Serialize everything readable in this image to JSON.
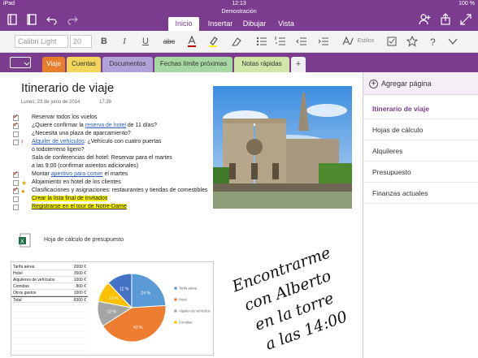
{
  "status_bar": {
    "carrier": "iPad",
    "time": "12:13",
    "battery": "100 %"
  },
  "document_title": "Demostración",
  "ribbon_tabs": [
    "Inicio",
    "Insertar",
    "Dibujar",
    "Vista"
  ],
  "ribbon": {
    "font_name": "Calibri Light",
    "font_size": "20",
    "styles_label": "Estilos"
  },
  "sections": [
    {
      "label": "Viaje",
      "color": "#e87d2b"
    },
    {
      "label": "Cuentas",
      "color": "#f2d65b"
    },
    {
      "label": "Documentos",
      "color": "#b0a1d8"
    },
    {
      "label": "Fechas límite próximas",
      "color": "#a8d8a1"
    },
    {
      "label": "Notas rápidas",
      "color": "#cfe6a7"
    }
  ],
  "pages_panel": {
    "add_label": "Agregar página",
    "pages": [
      "Itinerario de viaje",
      "Hojas de cálculo",
      "Alquileres",
      "Presupuesto",
      "Finanzas actuales"
    ]
  },
  "note": {
    "title": "Itinerario de viaje",
    "date": "Lunes, 23 de junio de 2014",
    "time": "17:36",
    "todos": [
      {
        "text": "Reservar todos los vuelos"
      },
      {
        "pre": "¿Quiere confirmar la ",
        "link": "reserva de hotel",
        "post": " de 11 días?"
      },
      {
        "text": "¿Necesita una plaza de aparcamiento?"
      },
      {
        "link": "Alquiler de vehículos",
        "post": ": ¿Vehículo con cuatro puertas"
      },
      {
        "text": "o todoterreno ligero?"
      },
      {
        "text": "Sala de conferencias del hotel: Reservar para el martes"
      },
      {
        "text": "a las 9:00 (confirmar asientos adicionales)"
      },
      {
        "pre": "Montar ",
        "link": "aperitivo para comer",
        "post": " el martes"
      },
      {
        "text": "Alojamiento en hotel de los clientes"
      },
      {
        "text": "Clasificaciones y asignaciones: restaurantes y tiendas de comestibles"
      },
      {
        "text": "Crear la lista final de invitados"
      },
      {
        "text": "Registrarse en el tour de Notre-Dame"
      }
    ],
    "attachment_label": "Hoja de cálculo de presupuesto",
    "handwriting": [
      "Encontrarme",
      "con Alberto",
      "en la torre",
      "a las 14:00"
    ]
  },
  "spreadsheet": {
    "rows": [
      {
        "label": "Tarifa aérea",
        "value": "2000 €"
      },
      {
        "label": "Hotel",
        "value": "3500 €"
      },
      {
        "label": "Alquileres de vehículos",
        "value": "1000 €"
      },
      {
        "label": "Comidas",
        "value": "800 €"
      },
      {
        "label": "Otros gastos",
        "value": "1000 €"
      },
      {
        "label": "Total",
        "value": "8300 €"
      }
    ]
  },
  "chart_data": {
    "type": "pie",
    "labels": [
      "Tarifa aérea",
      "Hotel",
      "Alquiler de vehículos",
      "Comidas",
      "Otros gastos"
    ],
    "values": [
      24,
      42,
      12,
      10,
      12
    ],
    "data_labels": [
      "24 %",
      "42 %",
      "12 %",
      "10 %",
      "12 %"
    ],
    "legend": [
      "Tarifa aérea",
      "Hotel",
      "Alquiler de vehículos",
      "Comidas"
    ],
    "colors": [
      "#5b9bd5",
      "#ed7d31",
      "#a5a5a5",
      "#ffc000",
      "#4472c4"
    ],
    "legend_position": "right"
  },
  "colors": {
    "accent": "#7b3c8f",
    "highlight": "#f8f200",
    "link": "#2c5fbd",
    "check": "#c0392b"
  }
}
